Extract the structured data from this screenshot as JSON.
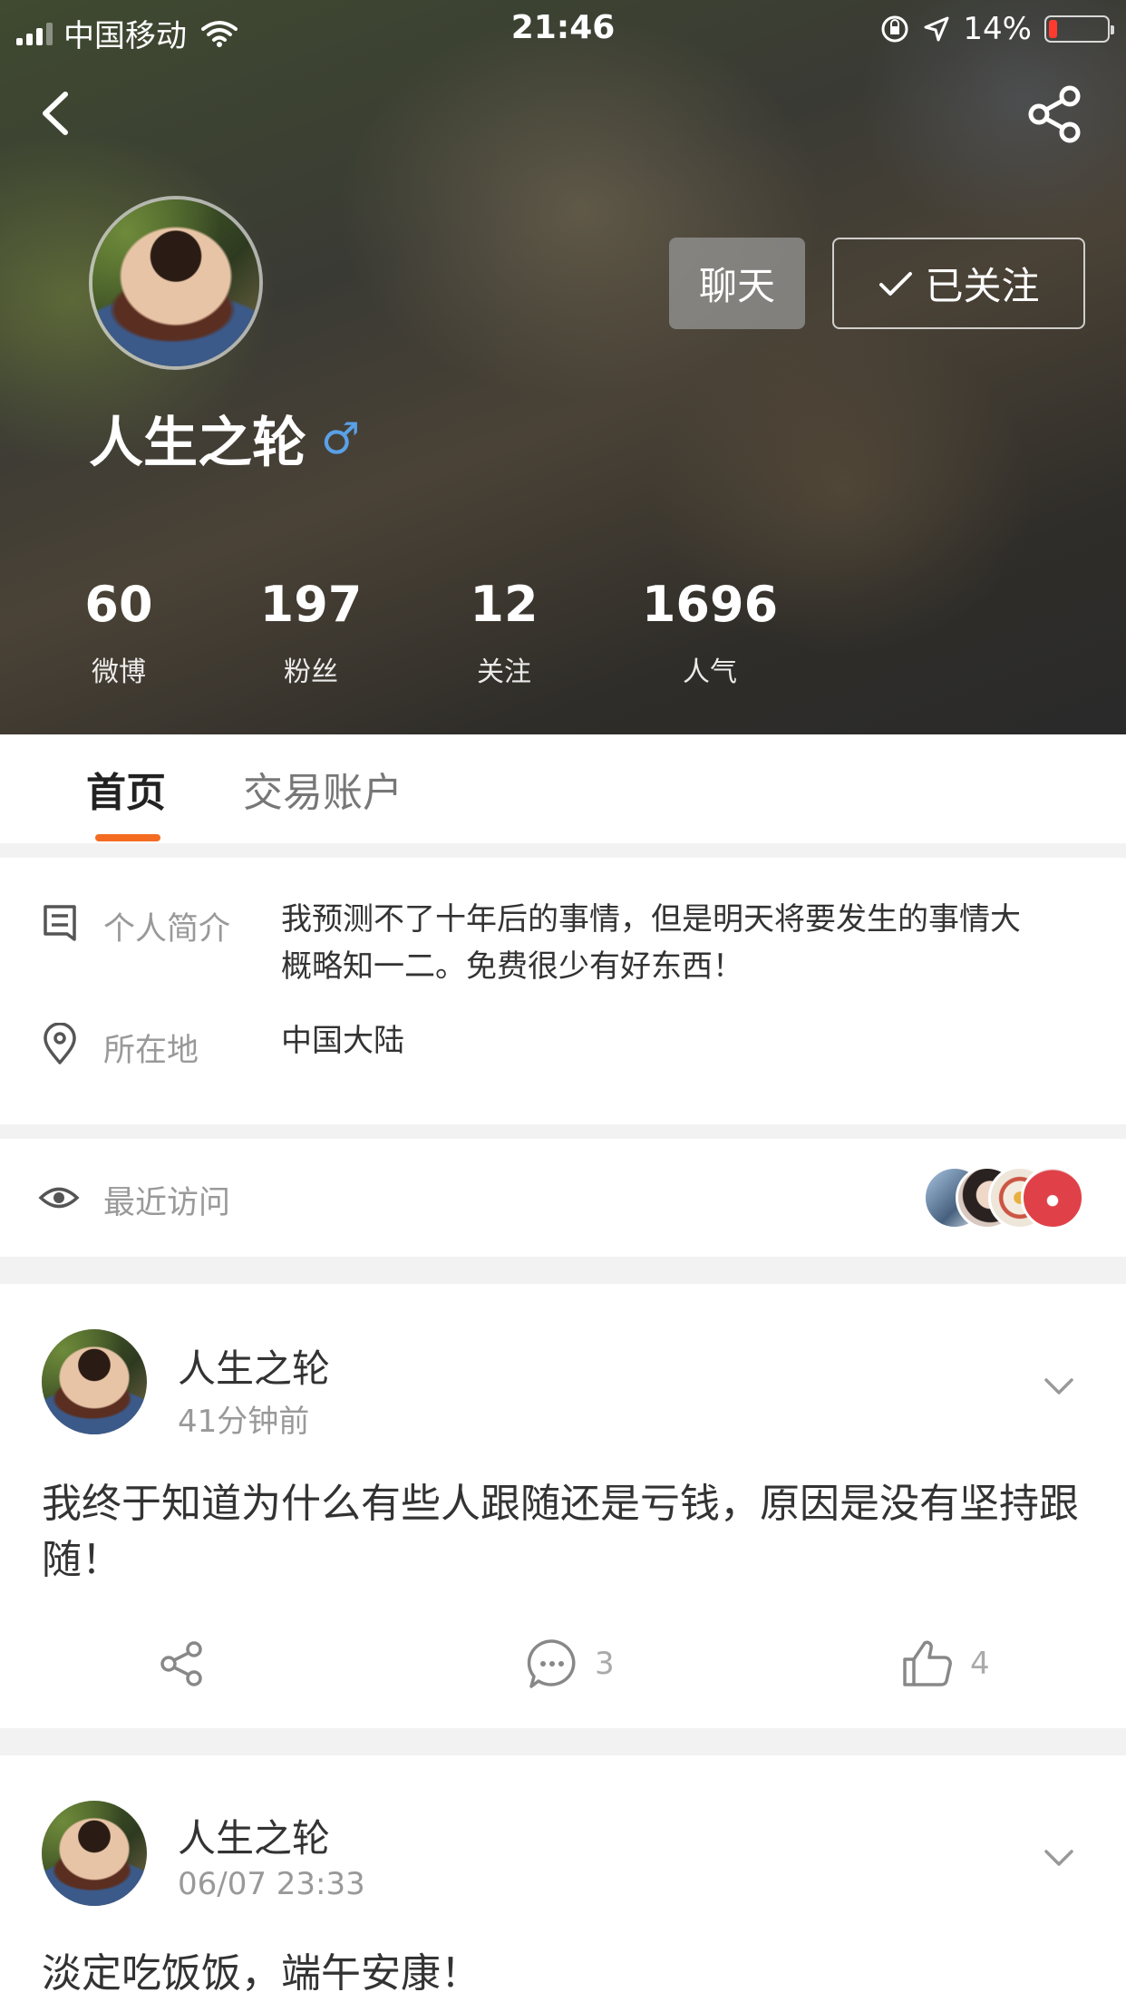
{
  "status_bar": {
    "carrier": "中国移动",
    "time": "21:46",
    "battery": "14%",
    "battery_level": 0.14
  },
  "profile": {
    "name": "人生之轮",
    "gender_symbol": "♂",
    "chat_label": "聊天",
    "follow_label": "已关注",
    "stats": [
      {
        "value": "60",
        "label": "微博"
      },
      {
        "value": "197",
        "label": "粉丝"
      },
      {
        "value": "12",
        "label": "关注"
      },
      {
        "value": "1696",
        "label": "人气"
      }
    ]
  },
  "tabs": {
    "home": "首页",
    "trading": "交易账户"
  },
  "info": {
    "bio_label": "个人简介",
    "bio_text": "我预测不了十年后的事情，但是明天将要发生的事情大概略知一二。免费很少有好东西！",
    "location_label": "所在地",
    "location_value": "中国大陆"
  },
  "recent_visits": {
    "label": "最近访问"
  },
  "posts": [
    {
      "author": "人生之轮",
      "time": "41分钟前",
      "text": "我终于知道为什么有些人跟随还是亏钱，原因是没有坚持跟随！",
      "comments": "3",
      "likes": "4"
    },
    {
      "author": "人生之轮",
      "time": "06/07 23:33",
      "text": "淡定吃饭饭，端午安康！"
    }
  ],
  "colors": {
    "accent": "#f36c21",
    "male": "#5aa0e6",
    "battery_low": "#ff3b30"
  },
  "icons": [
    "back-icon",
    "share-icon",
    "check-icon",
    "bio-icon",
    "location-icon",
    "eye-icon",
    "chevron-down-icon",
    "repost-icon",
    "comment-icon",
    "like-icon"
  ]
}
